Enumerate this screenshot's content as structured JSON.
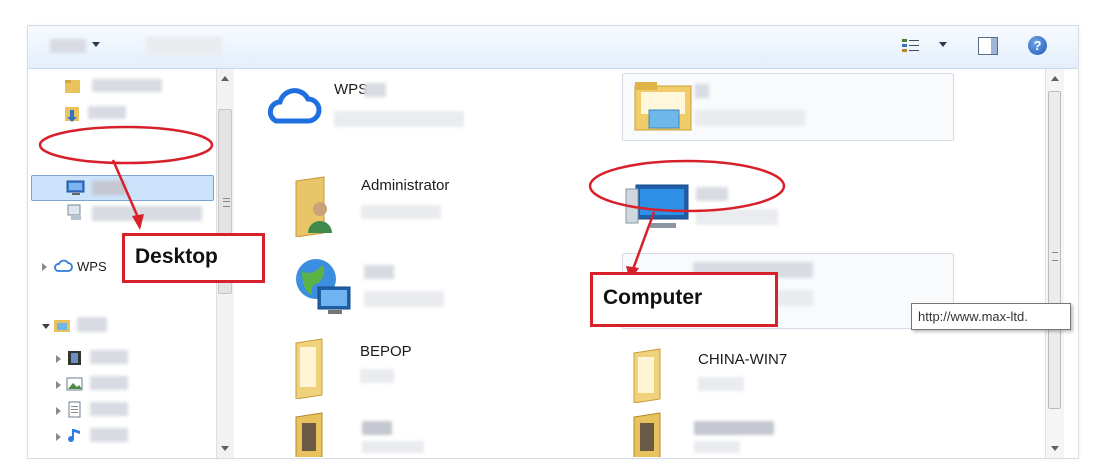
{
  "toolbar": {
    "views_icon": "view-options-icon",
    "preview_icon": "preview-pane-icon",
    "help_icon": "help-icon",
    "help_glyph": "?"
  },
  "sidebar": {
    "wps_label": "WPS",
    "items": [
      {
        "icon": "folder-icon"
      },
      {
        "icon": "downloads-icon"
      },
      {
        "icon": "desktop-icon"
      },
      {
        "icon": "network-places-icon"
      },
      {
        "icon": "wps-cloud-icon"
      },
      {
        "icon": "libraries-icon"
      },
      {
        "icon": "videos-icon"
      },
      {
        "icon": "pictures-icon"
      },
      {
        "icon": "documents-icon"
      },
      {
        "icon": "music-icon"
      }
    ]
  },
  "content": {
    "items": [
      {
        "name": "WPS",
        "icon": "wps-cloud-icon"
      },
      {
        "name": "",
        "icon": "library-folder-icon"
      },
      {
        "name": "Administrator",
        "icon": "user-folder-icon"
      },
      {
        "name": "",
        "icon": "computer-icon"
      },
      {
        "name": "",
        "icon": "network-icon"
      },
      {
        "name": "",
        "icon": "control-panel-icon"
      },
      {
        "name": "BEPOP",
        "icon": "folder-icon"
      },
      {
        "name": "CHINA-WIN7",
        "icon": "folder-icon"
      },
      {
        "name": "",
        "icon": "folder-icon"
      },
      {
        "name": "",
        "icon": "folder-icon"
      }
    ]
  },
  "tooltip": {
    "text": "http://www.max-ltd."
  },
  "annotations": {
    "desktop_label": "Desktop",
    "computer_label": "Computer",
    "color": "#d8202a"
  }
}
